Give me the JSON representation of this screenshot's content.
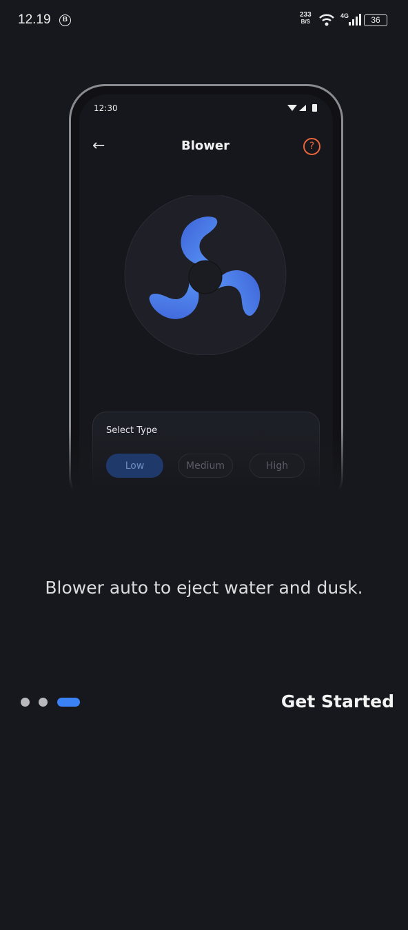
{
  "status_bar": {
    "time": "12.19",
    "notification_icon": "B",
    "speed_value": "233",
    "speed_unit": "B/S",
    "network": "4G",
    "battery": "36"
  },
  "mockup": {
    "status_time": "12:30",
    "title": "Blower",
    "back_icon": "arrow-left-icon",
    "help_icon": "question-circle-icon",
    "help_color": "#e8643c",
    "fan_color": "#4a7ff0",
    "card": {
      "title": "Select Type",
      "options": [
        "Low",
        "Medium",
        "High"
      ],
      "selected": "Low"
    }
  },
  "onboarding": {
    "tagline": "Blower auto to eject water and dusk.",
    "page_count": 3,
    "current_page": 3,
    "cta": "Get Started",
    "accent": "#3b82f6"
  }
}
